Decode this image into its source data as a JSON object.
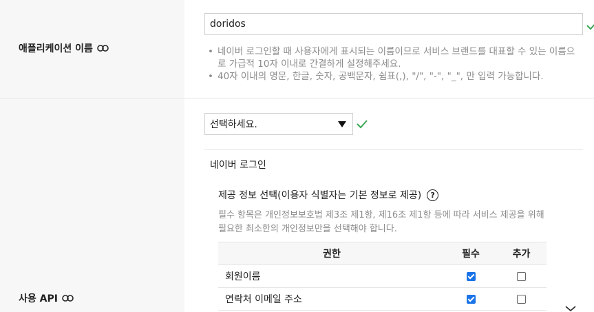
{
  "app_name": {
    "label": "애플리케이션 이름",
    "value": "doridos",
    "hints": [
      "네이버 로그인할 때 사용자에게 표시되는 이름이므로 서비스 브랜드를 대표할 수 있는 이름으로 가급적 10자 이내로 간결하게 설정해주세요.",
      "40자 이내의 영문, 한글, 숫자, 공백문자, 쉼표(,), \"/\", \"-\", \"_\", 만 입력 가능합니다."
    ]
  },
  "api": {
    "label": "사용 API",
    "select_value": "선택하세요.",
    "section_title": "네이버 로그인",
    "info_title": "제공 정보 선택(이용자 식별자는 기본 정보로 제공)",
    "info_desc": "필수 항목은 개인정보보호법 제3조 제1항, 제16조 제1항 등에 따라 서비스 제공을 위해 필요한 최소한의 개인정보만을 선택해야 합니다.",
    "table": {
      "headers": [
        "권한",
        "필수",
        "추가"
      ],
      "rows": [
        {
          "name": "회원이름",
          "required": true,
          "additional": false
        },
        {
          "name": "연락처 이메일 주소",
          "required": true,
          "additional": false
        }
      ]
    }
  },
  "colors": {
    "check_green": "#3aa655",
    "checkbox_blue": "#1a73e8",
    "label_bg": "#f7f7f8"
  },
  "icons": [
    "link-icon",
    "checkmark-icon",
    "dropdown-arrow-icon",
    "help-circle-icon",
    "chevron-down-icon"
  ]
}
